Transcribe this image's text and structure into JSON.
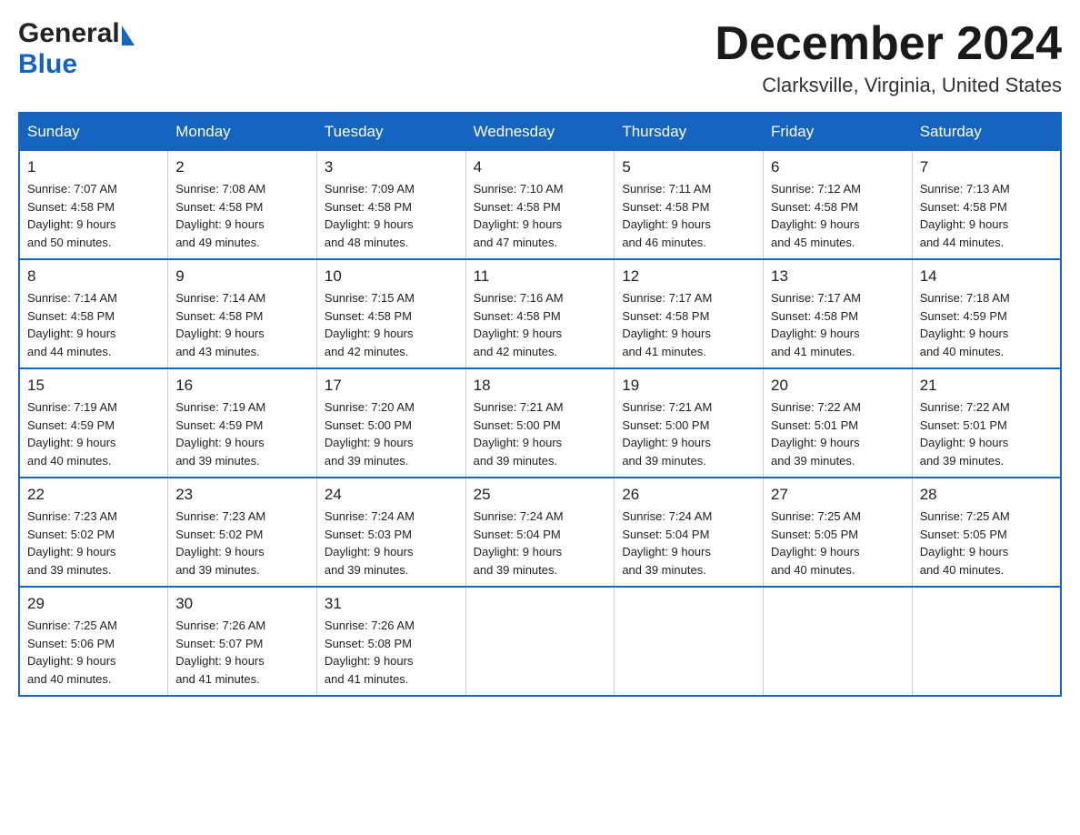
{
  "header": {
    "logo_general": "General",
    "logo_blue": "Blue",
    "month_title": "December 2024",
    "location": "Clarksville, Virginia, United States"
  },
  "weekdays": [
    "Sunday",
    "Monday",
    "Tuesday",
    "Wednesday",
    "Thursday",
    "Friday",
    "Saturday"
  ],
  "weeks": [
    [
      {
        "day": "1",
        "sunrise": "7:07 AM",
        "sunset": "4:58 PM",
        "daylight": "9 hours and 50 minutes."
      },
      {
        "day": "2",
        "sunrise": "7:08 AM",
        "sunset": "4:58 PM",
        "daylight": "9 hours and 49 minutes."
      },
      {
        "day": "3",
        "sunrise": "7:09 AM",
        "sunset": "4:58 PM",
        "daylight": "9 hours and 48 minutes."
      },
      {
        "day": "4",
        "sunrise": "7:10 AM",
        "sunset": "4:58 PM",
        "daylight": "9 hours and 47 minutes."
      },
      {
        "day": "5",
        "sunrise": "7:11 AM",
        "sunset": "4:58 PM",
        "daylight": "9 hours and 46 minutes."
      },
      {
        "day": "6",
        "sunrise": "7:12 AM",
        "sunset": "4:58 PM",
        "daylight": "9 hours and 45 minutes."
      },
      {
        "day": "7",
        "sunrise": "7:13 AM",
        "sunset": "4:58 PM",
        "daylight": "9 hours and 44 minutes."
      }
    ],
    [
      {
        "day": "8",
        "sunrise": "7:14 AM",
        "sunset": "4:58 PM",
        "daylight": "9 hours and 44 minutes."
      },
      {
        "day": "9",
        "sunrise": "7:14 AM",
        "sunset": "4:58 PM",
        "daylight": "9 hours and 43 minutes."
      },
      {
        "day": "10",
        "sunrise": "7:15 AM",
        "sunset": "4:58 PM",
        "daylight": "9 hours and 42 minutes."
      },
      {
        "day": "11",
        "sunrise": "7:16 AM",
        "sunset": "4:58 PM",
        "daylight": "9 hours and 42 minutes."
      },
      {
        "day": "12",
        "sunrise": "7:17 AM",
        "sunset": "4:58 PM",
        "daylight": "9 hours and 41 minutes."
      },
      {
        "day": "13",
        "sunrise": "7:17 AM",
        "sunset": "4:58 PM",
        "daylight": "9 hours and 41 minutes."
      },
      {
        "day": "14",
        "sunrise": "7:18 AM",
        "sunset": "4:59 PM",
        "daylight": "9 hours and 40 minutes."
      }
    ],
    [
      {
        "day": "15",
        "sunrise": "7:19 AM",
        "sunset": "4:59 PM",
        "daylight": "9 hours and 40 minutes."
      },
      {
        "day": "16",
        "sunrise": "7:19 AM",
        "sunset": "4:59 PM",
        "daylight": "9 hours and 39 minutes."
      },
      {
        "day": "17",
        "sunrise": "7:20 AM",
        "sunset": "5:00 PM",
        "daylight": "9 hours and 39 minutes."
      },
      {
        "day": "18",
        "sunrise": "7:21 AM",
        "sunset": "5:00 PM",
        "daylight": "9 hours and 39 minutes."
      },
      {
        "day": "19",
        "sunrise": "7:21 AM",
        "sunset": "5:00 PM",
        "daylight": "9 hours and 39 minutes."
      },
      {
        "day": "20",
        "sunrise": "7:22 AM",
        "sunset": "5:01 PM",
        "daylight": "9 hours and 39 minutes."
      },
      {
        "day": "21",
        "sunrise": "7:22 AM",
        "sunset": "5:01 PM",
        "daylight": "9 hours and 39 minutes."
      }
    ],
    [
      {
        "day": "22",
        "sunrise": "7:23 AM",
        "sunset": "5:02 PM",
        "daylight": "9 hours and 39 minutes."
      },
      {
        "day": "23",
        "sunrise": "7:23 AM",
        "sunset": "5:02 PM",
        "daylight": "9 hours and 39 minutes."
      },
      {
        "day": "24",
        "sunrise": "7:24 AM",
        "sunset": "5:03 PM",
        "daylight": "9 hours and 39 minutes."
      },
      {
        "day": "25",
        "sunrise": "7:24 AM",
        "sunset": "5:04 PM",
        "daylight": "9 hours and 39 minutes."
      },
      {
        "day": "26",
        "sunrise": "7:24 AM",
        "sunset": "5:04 PM",
        "daylight": "9 hours and 39 minutes."
      },
      {
        "day": "27",
        "sunrise": "7:25 AM",
        "sunset": "5:05 PM",
        "daylight": "9 hours and 40 minutes."
      },
      {
        "day": "28",
        "sunrise": "7:25 AM",
        "sunset": "5:05 PM",
        "daylight": "9 hours and 40 minutes."
      }
    ],
    [
      {
        "day": "29",
        "sunrise": "7:25 AM",
        "sunset": "5:06 PM",
        "daylight": "9 hours and 40 minutes."
      },
      {
        "day": "30",
        "sunrise": "7:26 AM",
        "sunset": "5:07 PM",
        "daylight": "9 hours and 41 minutes."
      },
      {
        "day": "31",
        "sunrise": "7:26 AM",
        "sunset": "5:08 PM",
        "daylight": "9 hours and 41 minutes."
      },
      null,
      null,
      null,
      null
    ]
  ],
  "labels": {
    "sunrise": "Sunrise:",
    "sunset": "Sunset:",
    "daylight": "Daylight:"
  }
}
